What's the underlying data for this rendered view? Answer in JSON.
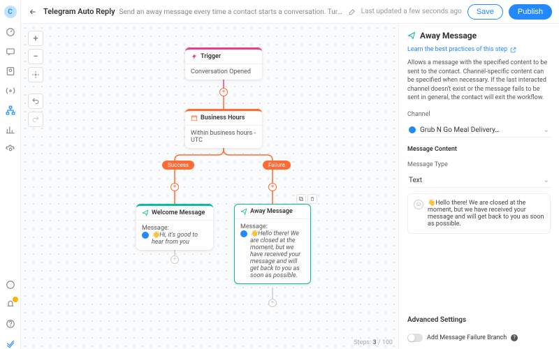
{
  "header": {
    "title": "Telegram Auto Reply",
    "description": "Send an away message every time a contact starts a conversation. Turn it on and off by toggling the workflow on and off.",
    "last_updated": "Last updated a few seconds ago",
    "save_label": "Save",
    "publish_label": "Publish"
  },
  "left_rail": {
    "avatar_letter": "C",
    "icons": [
      "gauge-icon",
      "chat-icon",
      "contact-icon",
      "broadcast-icon",
      "workflow-icon",
      "reports-icon",
      "settings-icon"
    ],
    "bottom_icons": [
      "announce-icon",
      "notify-icon",
      "help-icon",
      "brand-icon"
    ]
  },
  "canvas": {
    "zoom_plus": "+",
    "zoom_minus": "−",
    "steps_label": "Steps:",
    "steps_current": "3",
    "steps_max": "100",
    "nodes": {
      "trigger": {
        "title": "Trigger",
        "body": "Conversation Opened"
      },
      "business_hours": {
        "title": "Business Hours",
        "body": "Within business hours - UTC"
      },
      "welcome": {
        "title": "Welcome Message",
        "label": "Message:",
        "body": "👋Hi, it's good to hear from you"
      },
      "away": {
        "title": "Away Message",
        "label": "Message:",
        "body": "👋Hello there! We are closed at the moment, but we have received your message and will get back to you as soon as possible."
      }
    },
    "branch_labels": {
      "success": "Success",
      "failure": "Failure"
    }
  },
  "right_panel": {
    "title": "Away Message",
    "best_practices": "Learn the best practices of this step",
    "description": "Allows a message with the specified content to be sent to the contact. Channel-specific content can be specified when necessary. If the last interacted channel doesn't exist or the message fails to be sent in general, the contact will exit the workflow.",
    "channel_label": "Channel",
    "channel_value": "Grub N Go Meal Delivery…",
    "content_label": "Message Content",
    "type_label": "Message Type",
    "type_value": "Text",
    "content_body": "👋Hello there! We are closed at the moment, but we have received your message and will get back to you as soon as possible.",
    "advanced_heading": "Advanced Settings",
    "toggle_label": "Add Message Failure Branch"
  }
}
